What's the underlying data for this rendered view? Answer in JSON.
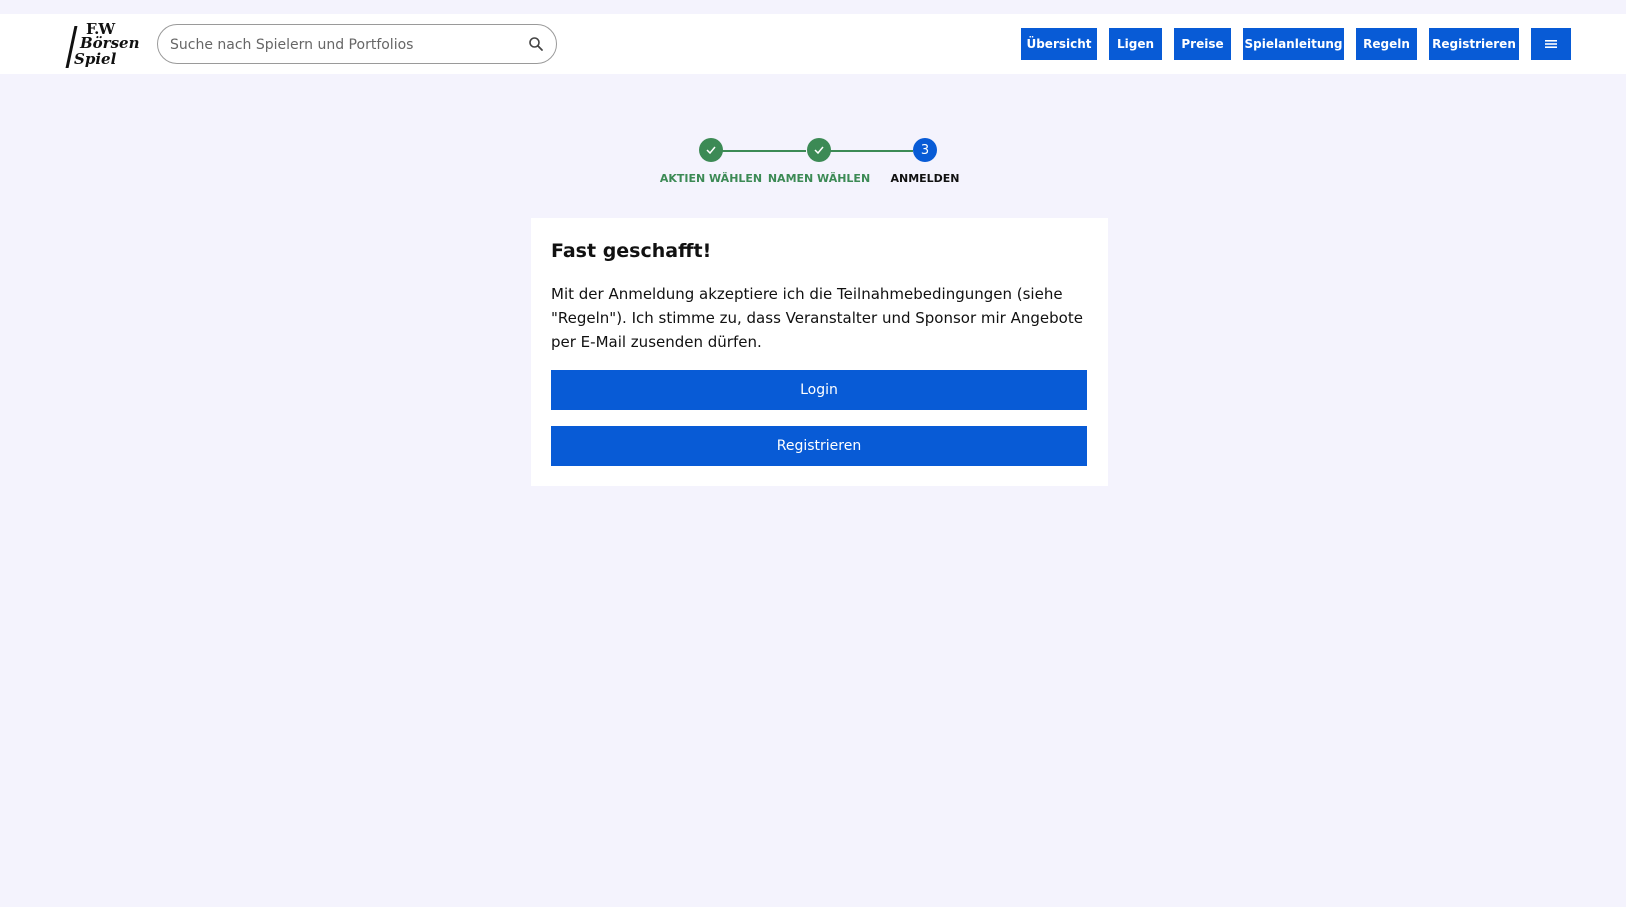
{
  "header": {
    "logo": {
      "line1": "F.W",
      "line2": "Börsen",
      "line3": "Spiel"
    },
    "search": {
      "placeholder": "Suche nach Spielern und Portfolios",
      "icon": "search-icon"
    },
    "nav": [
      {
        "label": "Übersicht"
      },
      {
        "label": "Ligen"
      },
      {
        "label": "Preise"
      },
      {
        "label": "Spielanleitung"
      },
      {
        "label": "Regeln"
      },
      {
        "label": "Registrieren"
      }
    ],
    "menu_icon": "hamburger-menu-icon"
  },
  "stepper": {
    "steps": [
      {
        "label": "AKTIEN WÄHLEN",
        "status": "done",
        "icon": "check-icon"
      },
      {
        "label": "NAMEN WÄHLEN",
        "status": "done",
        "icon": "check-icon"
      },
      {
        "label": "ANMELDEN",
        "status": "active",
        "number": "3"
      }
    ],
    "colors": {
      "done": "#3c8a55",
      "active": "#085bd6"
    }
  },
  "card": {
    "title": "Fast geschafft!",
    "text": "Mit der Anmeldung akzeptiere ich die Teilnahmebedingungen (siehe \"Regeln\"). Ich stimme zu, dass Veranstalter und Sponsor mir Angebote per E-Mail zusenden dürfen.",
    "login_label": "Login",
    "register_label": "Registrieren"
  },
  "colors": {
    "accent": "#085bd6",
    "background": "#f4f3fd",
    "success": "#3c8a55"
  }
}
